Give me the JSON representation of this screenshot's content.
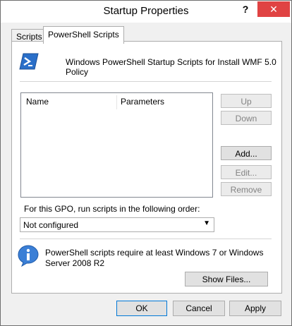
{
  "window": {
    "title": "Startup Properties",
    "help_label": "?",
    "close_label": "✕"
  },
  "tabs": [
    {
      "label": "Scripts",
      "active": false
    },
    {
      "label": "PowerShell Scripts",
      "active": true
    }
  ],
  "header": {
    "description": "Windows PowerShell Startup Scripts for Install WMF 5.0 Policy",
    "icon": "powershell-icon"
  },
  "script_list": {
    "columns": [
      "Name",
      "Parameters"
    ],
    "rows": []
  },
  "side_buttons": {
    "up": "Up",
    "down": "Down",
    "add": "Add...",
    "edit": "Edit...",
    "remove": "Remove"
  },
  "order": {
    "label": "For this GPO, run scripts in the following order:",
    "selected": "Not configured"
  },
  "info": {
    "icon": "info-icon",
    "text": "PowerShell scripts require at least Windows 7 or Windows Server 2008 R2"
  },
  "show_files_label": "Show Files...",
  "footer": {
    "ok": "OK",
    "cancel": "Cancel",
    "apply": "Apply"
  }
}
